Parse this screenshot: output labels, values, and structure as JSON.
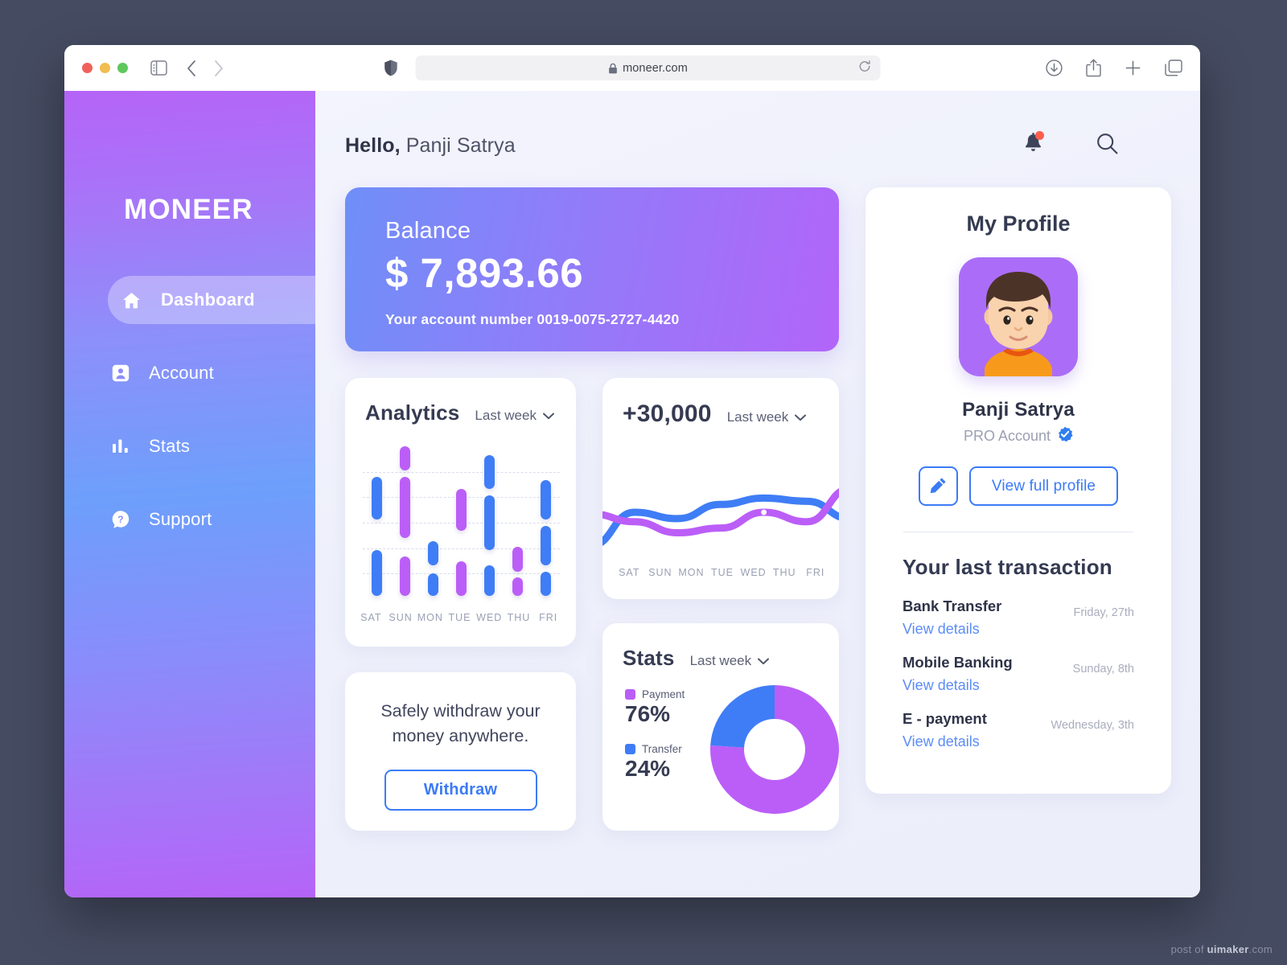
{
  "browser": {
    "url": "moneer.com",
    "icons": {
      "sidebar_toggle": "sidebar-toggle-icon",
      "back": "back-arrow-icon",
      "forward": "forward-arrow-icon",
      "shield": "shield-icon",
      "lock": "lock-icon",
      "reload": "reload-icon",
      "download": "download-icon",
      "share": "share-icon",
      "new_tab": "plus-icon",
      "tabs": "tabs-icon"
    }
  },
  "sidebar": {
    "logo": "MONEER",
    "items": [
      {
        "label": "Dashboard",
        "icon": "home-icon",
        "active": true
      },
      {
        "label": "Account",
        "icon": "user-icon",
        "active": false
      },
      {
        "label": "Stats",
        "icon": "bar-chart-icon",
        "active": false
      },
      {
        "label": "Support",
        "icon": "help-circle-icon",
        "active": false
      }
    ]
  },
  "topbar": {
    "greeting": "Hello,",
    "user_name": "Panji Satrya",
    "bell_icon": "bell-icon",
    "search_icon": "search-icon",
    "has_notification": true
  },
  "balance": {
    "label": "Balance",
    "amount": "$ 7,893.66",
    "account_line": "Your account number 0019-0075-2727-4420"
  },
  "withdraw": {
    "text": "Safely withdraw your money anywhere.",
    "button": "Withdraw"
  },
  "profile": {
    "title": "My Profile",
    "name": "Panji Satrya",
    "account_type": "PRO Account",
    "verified_icon": "verified-badge-icon",
    "edit_icon": "pencil-icon",
    "view_button": "View full profile"
  },
  "transactions": {
    "title": "Your last transaction",
    "link_label": "View details",
    "items": [
      {
        "name": "Bank Transfer",
        "date": "Friday, 27th"
      },
      {
        "name": "Mobile Banking",
        "date": "Sunday, 8th"
      },
      {
        "name": "E - payment",
        "date": "Wednesday, 3th"
      }
    ]
  },
  "colors": {
    "purple": "#bb5ef7",
    "blue": "#3f7df6",
    "accent_link": "#3b7bf6",
    "text_dark": "#343a51",
    "text_muted": "#9aa0b4"
  },
  "watermark": {
    "prefix": "post of ",
    "brand": "uimaker",
    "suffix": ".com"
  },
  "chart_data": [
    {
      "type": "bar",
      "name": "analytics",
      "title": "Analytics",
      "period": "Last week",
      "xlabel": "",
      "ylabel": "",
      "grid": true,
      "gridlines": 5,
      "categories": [
        "SAT",
        "SUN",
        "MON",
        "TUE",
        "WED",
        "THU",
        "FRI"
      ],
      "note": "Floating range bars; each day has stacked segments given as [start,end] on a 0-100 scale with a color.",
      "segments": [
        {
          "day": "SAT",
          "color": "blue",
          "range": [
            52,
            80
          ]
        },
        {
          "day": "SAT",
          "color": "blue",
          "range": [
            2,
            32
          ]
        },
        {
          "day": "SUN",
          "color": "purple",
          "range": [
            84,
            100
          ]
        },
        {
          "day": "SUN",
          "color": "purple",
          "range": [
            40,
            80
          ]
        },
        {
          "day": "SUN",
          "color": "purple",
          "range": [
            2,
            28
          ]
        },
        {
          "day": "MON",
          "color": "blue",
          "range": [
            22,
            38
          ]
        },
        {
          "day": "MON",
          "color": "blue",
          "range": [
            2,
            17
          ]
        },
        {
          "day": "TUE",
          "color": "purple",
          "range": [
            45,
            72
          ]
        },
        {
          "day": "TUE",
          "color": "purple",
          "range": [
            2,
            25
          ]
        },
        {
          "day": "WED",
          "color": "blue",
          "range": [
            72,
            94
          ]
        },
        {
          "day": "WED",
          "color": "blue",
          "range": [
            32,
            68
          ]
        },
        {
          "day": "WED",
          "color": "blue",
          "range": [
            2,
            22
          ]
        },
        {
          "day": "THU",
          "color": "purple",
          "range": [
            18,
            34
          ]
        },
        {
          "day": "THU",
          "color": "purple",
          "range": [
            2,
            14
          ]
        },
        {
          "day": "FRI",
          "color": "blue",
          "range": [
            52,
            78
          ]
        },
        {
          "day": "FRI",
          "color": "blue",
          "range": [
            22,
            48
          ]
        },
        {
          "day": "FRI",
          "color": "blue",
          "range": [
            2,
            18
          ]
        }
      ]
    },
    {
      "type": "line",
      "name": "growth",
      "title": "+30,000",
      "period": "Last week",
      "xlabel": "",
      "ylabel": "",
      "grid": false,
      "categories": [
        "SAT",
        "SUN",
        "MON",
        "TUE",
        "WED",
        "THU",
        "FRI"
      ],
      "series": [
        {
          "name": "blue-line",
          "color": "#3f7df6",
          "values": [
            10,
            52,
            44,
            62,
            70,
            66,
            44
          ]
        },
        {
          "name": "purple-line",
          "color": "#bb5ef7",
          "values": [
            50,
            40,
            26,
            32,
            52,
            40,
            82
          ]
        }
      ],
      "marker": {
        "series": "purple-line",
        "at": "WED",
        "value": 52
      }
    },
    {
      "type": "pie",
      "name": "stats",
      "title": "Stats",
      "period": "Last week",
      "legend_position": "left",
      "labels": [
        "Payment",
        "Transfer"
      ],
      "values": [
        76,
        24
      ],
      "display_values": [
        "76%",
        "24%"
      ],
      "colors": [
        "#bb5ef7",
        "#3f7df6"
      ]
    }
  ]
}
